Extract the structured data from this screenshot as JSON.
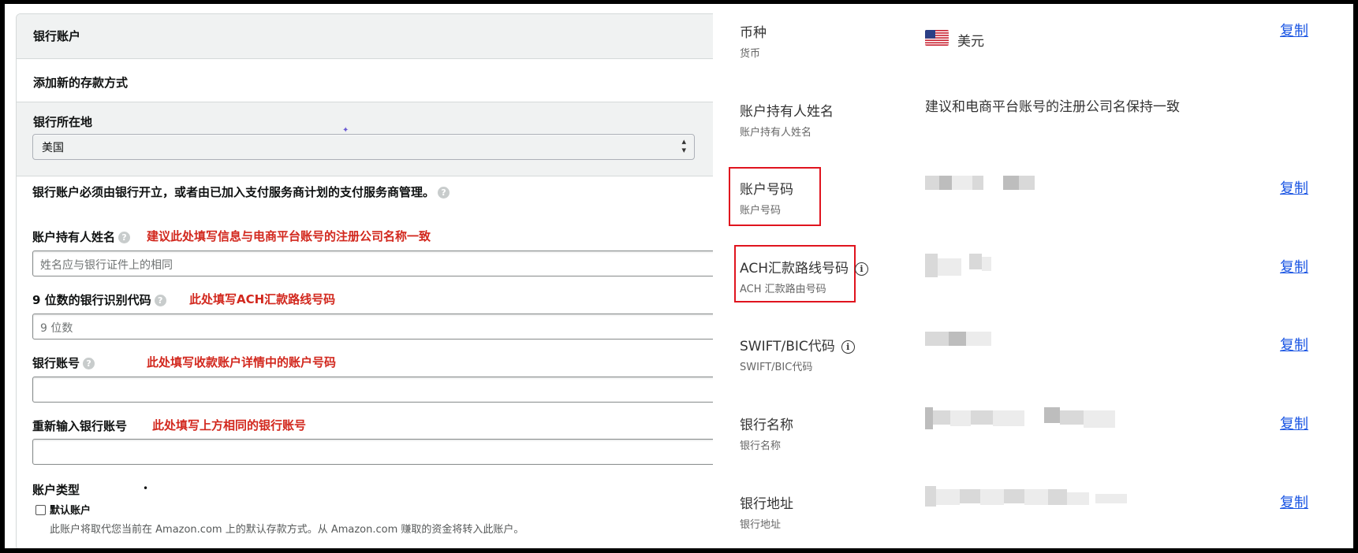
{
  "left": {
    "header_title": "银行账户",
    "add_method": "添加新的存款方式",
    "bank_location_label": "银行所在地",
    "bank_location_value": "美国",
    "intro_text": "银行账户必须由银行开立，或者由已加入支付服务商计划的支付服务商管理。",
    "holder_label": "账户持有人姓名",
    "holder_note": "建议此处填写信息与电商平台账号的注册公司名称一致",
    "holder_placeholder": "姓名应与银行证件上的相同",
    "routing_label": "9 位数的银行识别代码",
    "routing_note": "此处填写ACH汇款路线号码",
    "routing_placeholder": "9 位数",
    "account_label": "银行账号",
    "account_note": "此处填写收款账户详情中的账户号码",
    "reenter_label": "重新输入银行账号",
    "reenter_note": "此处填写上方相同的银行账号",
    "account_type_label": "账户类型",
    "default_account_label": "默认账户",
    "default_account_desc": "此账户将取代您当前在 Amazon.com 上的默认存款方式。从 Amazon.com 赚取的资金将转入此账户。"
  },
  "right": {
    "copy_label": "复制",
    "rows": [
      {
        "label": "币种",
        "sub": "货币",
        "value": "美元",
        "icon": "us-flag-icon"
      },
      {
        "label": "账户持有人姓名",
        "sub": "账户持有人姓名",
        "value": "建议和电商平台账号的注册公司名保持一致"
      },
      {
        "label": "账户号码",
        "sub": "账户号码",
        "value": ""
      },
      {
        "label": "ACH汇款路线号码",
        "sub": "ACH 汇款路由号码",
        "value": "",
        "icon": "info-icon"
      },
      {
        "label": "SWIFT/BIC代码",
        "sub": "SWIFT/BIC代码",
        "value": "",
        "icon": "info-icon"
      },
      {
        "label": "银行名称",
        "sub": "银行名称",
        "value": ""
      },
      {
        "label": "银行地址",
        "sub": "银行地址",
        "value": ""
      }
    ]
  },
  "colors": {
    "note_red": "#d2281e",
    "highlight_box": "#e0141e",
    "link_blue": "#1a55e3"
  }
}
